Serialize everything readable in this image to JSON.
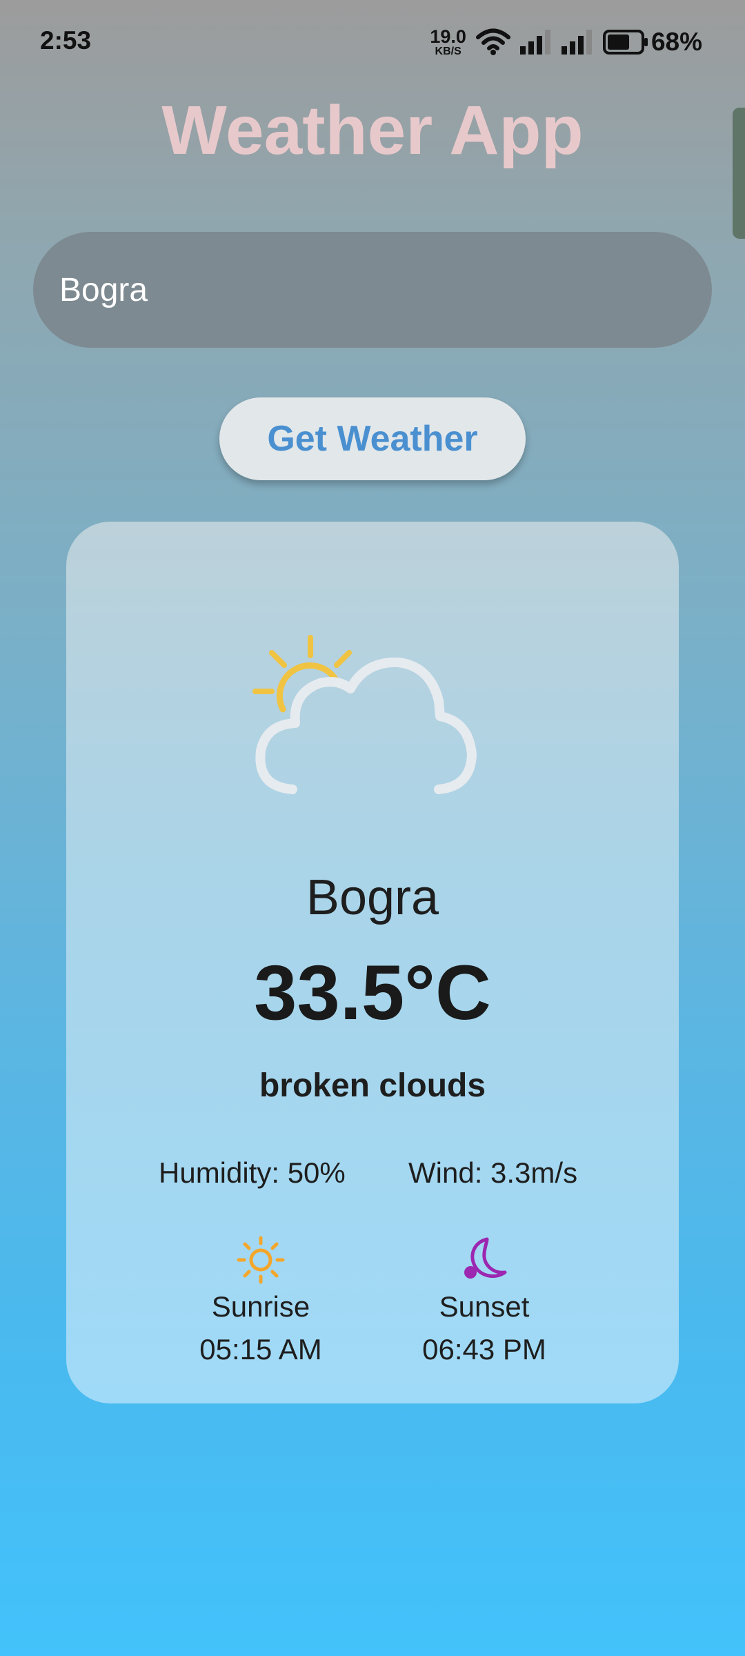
{
  "status_bar": {
    "time": "2:53",
    "net_speed_value": "19.0",
    "net_speed_unit": "KB/S",
    "battery_percent": "68%",
    "battery_level": 0.68
  },
  "app": {
    "title": "Weather App"
  },
  "search": {
    "value": "Bogra"
  },
  "actions": {
    "get_weather_label": "Get Weather"
  },
  "weather": {
    "icon": "partly-cloudy-icon",
    "city": "Bogra",
    "temperature": "33.5°C",
    "description": "broken clouds",
    "humidity": "Humidity: 50%",
    "wind": "Wind: 3.3m/s",
    "sunrise": {
      "icon": "sun-icon",
      "label": "Sunrise",
      "time": "05:15 AM"
    },
    "sunset": {
      "icon": "moon-icon",
      "label": "Sunset",
      "time": "06:43 PM"
    }
  },
  "colors": {
    "title": "#e8c9cb",
    "button_text": "#4a90d0",
    "sun_accent": "#f4a62a",
    "moon_accent": "#9c27b0"
  }
}
